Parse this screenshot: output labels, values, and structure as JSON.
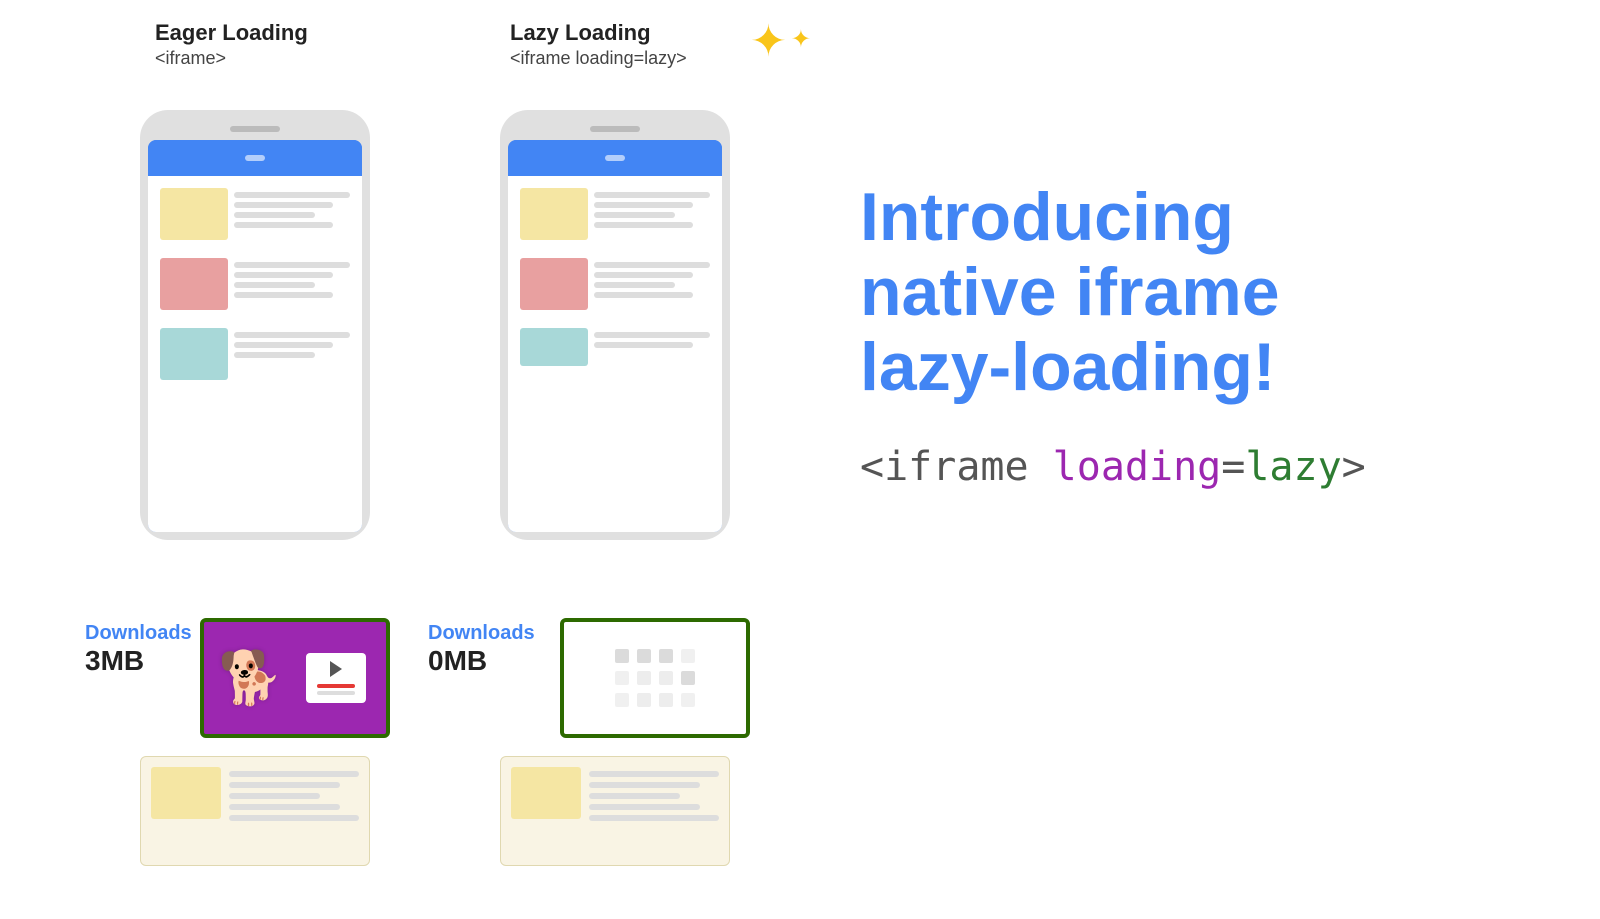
{
  "eager": {
    "title": "Eager Loading",
    "subtitle": "<iframe>",
    "downloads_label": "Downloads",
    "downloads_amount": "3MB"
  },
  "lazy": {
    "title": "Lazy Loading",
    "subtitle": "<iframe loading=lazy>",
    "downloads_label": "Downloads",
    "downloads_amount": "0MB"
  },
  "headline": {
    "line1": "Introducing",
    "line2": "native iframe",
    "line3": "lazy-loading!"
  },
  "code": {
    "part1": "<iframe ",
    "part2": "loading",
    "part3": "=",
    "part4": "lazy",
    "part5": ">"
  },
  "sparkle": {
    "big": "✦",
    "small": "✦"
  }
}
